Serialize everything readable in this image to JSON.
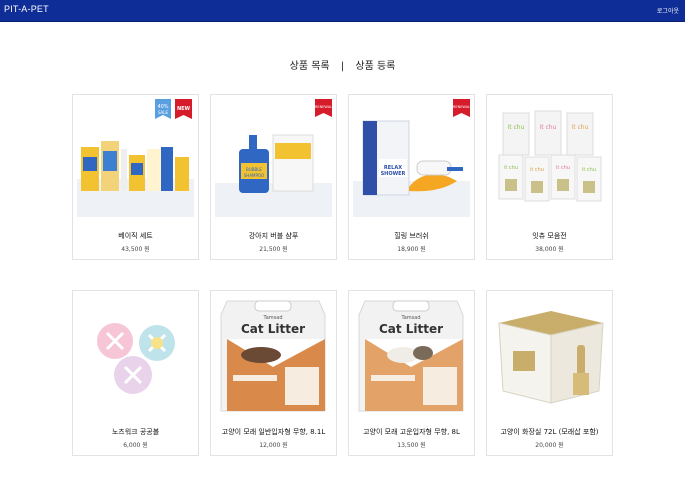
{
  "header": {
    "brand": "PIT-A-PET",
    "logout_label": "로그아웃"
  },
  "tabs": {
    "product_list": "상품 목록",
    "separator": "|",
    "product_register": "상품 등록"
  },
  "products": [
    {
      "name": "베이직 세트",
      "price": "43,500 원",
      "badges": [
        "40%\nSALE",
        "NEW"
      ]
    },
    {
      "name": "강아지 버블 샴푸",
      "price": "21,500 원",
      "badges": [
        "RENEWAL"
      ]
    },
    {
      "name": "힐링 브러쉬",
      "price": "18,900 원",
      "badges": [
        "RENEWAL"
      ]
    },
    {
      "name": "잇츄 모음전",
      "price": "38,000 원",
      "badges": []
    },
    {
      "name": "노즈워크 공공볼",
      "price": "6,000 원",
      "badges": []
    },
    {
      "name": "고양이 모래 일반입자형 무향, 8.1L",
      "price": "12,000 원",
      "badges": []
    },
    {
      "name": "고양이 모래 고운입자형 무향, 8L",
      "price": "13,500 원",
      "badges": []
    },
    {
      "name": "고양이 화장실 72L (모래삽 포함)",
      "price": "20,000 원",
      "badges": []
    }
  ],
  "product_images": {
    "cat_litter_brand": "Tamsad",
    "cat_litter_title": "Cat Litter",
    "shampoo_text": "BUBBLE SHAMPOO",
    "shower_text": "RELAX SHOWER",
    "itchu_text": "it chu"
  },
  "colors": {
    "topbar": "#0f2d96",
    "renewal_badge": "#d61c2a",
    "sale_badge": "#5aa0e0"
  }
}
